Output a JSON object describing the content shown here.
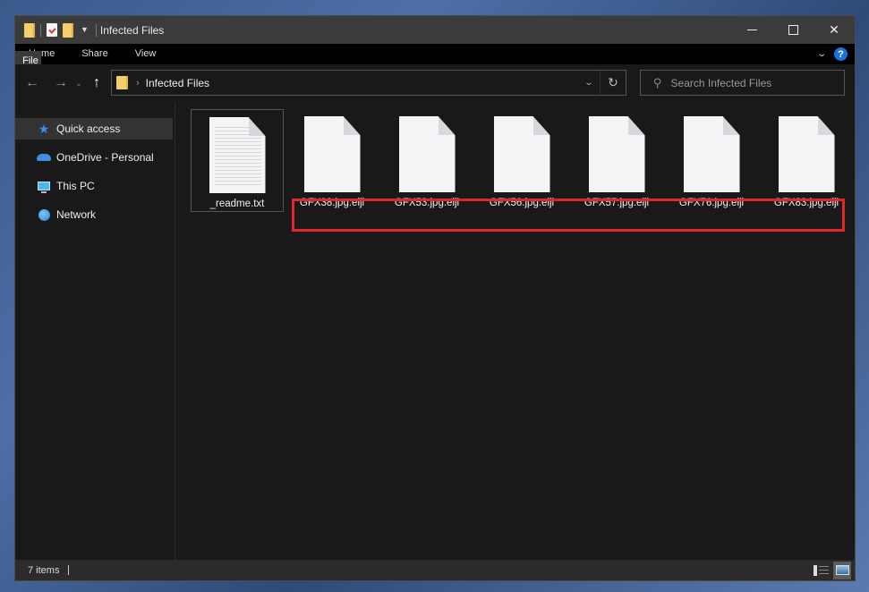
{
  "window": {
    "title": "Infected Files",
    "controls": {
      "minimize": "minimize",
      "maximize": "maximize",
      "close": "✕"
    }
  },
  "ribbon": {
    "tabs": [
      "File",
      "Home",
      "Share",
      "View"
    ],
    "help": "?"
  },
  "navigation": {
    "back": "←",
    "forward": "→",
    "recent": "⌄",
    "up": "↑",
    "breadcrumb": [
      "Infected Files"
    ],
    "refresh": "↻",
    "search_placeholder": "Search Infected Files",
    "search_value": ""
  },
  "sidebar": {
    "items": [
      {
        "label": "Quick access",
        "icon": "star-icon",
        "selected": true
      },
      {
        "label": "OneDrive - Personal",
        "icon": "cloud-icon",
        "selected": false
      },
      {
        "label": "This PC",
        "icon": "computer-icon",
        "selected": false
      },
      {
        "label": "Network",
        "icon": "network-icon",
        "selected": false
      }
    ]
  },
  "files": [
    {
      "name": "_readme.txt",
      "type": "text",
      "selected": true
    },
    {
      "name": "GFX38.jpg.eiji",
      "type": "blank",
      "selected": false
    },
    {
      "name": "GFX53.jpg.eiji",
      "type": "blank",
      "selected": false
    },
    {
      "name": "GFX56.jpg.eiji",
      "type": "blank",
      "selected": false
    },
    {
      "name": "GFX57.jpg.eiji",
      "type": "blank",
      "selected": false
    },
    {
      "name": "GFX76.jpg.eiji",
      "type": "blank",
      "selected": false
    },
    {
      "name": "GFX83.jpg.eiji",
      "type": "blank",
      "selected": false
    }
  ],
  "annotation": {
    "color": "#e0262c",
    "highlights": "encrypted files"
  },
  "status": {
    "item_count": "7 items"
  }
}
